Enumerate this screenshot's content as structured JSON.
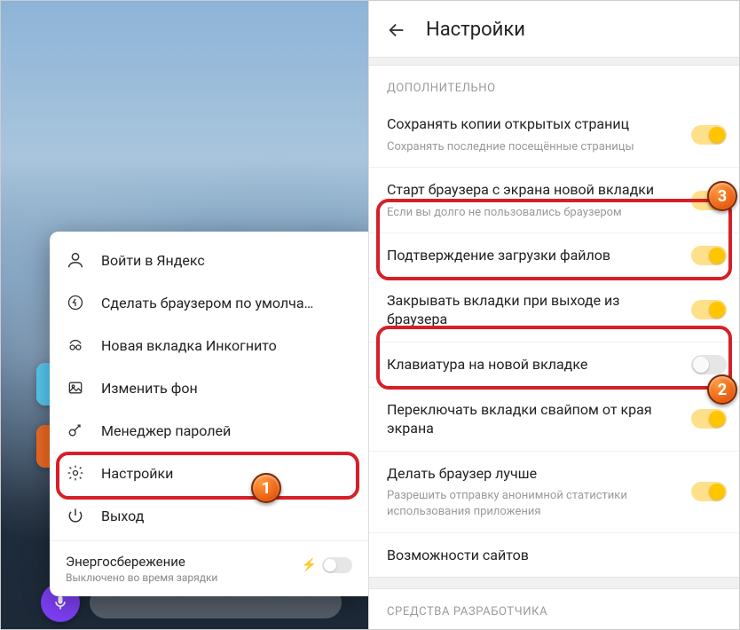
{
  "left": {
    "menu": {
      "login": "Войти в Яндекс",
      "default_browser": "Сделать браузером по умолча…",
      "incognito": "Новая вкладка Инкогнито",
      "change_bg": "Изменить фон",
      "pwd_manager": "Менеджер паролей",
      "settings": "Настройки",
      "exit": "Выход",
      "power_title": "Энергосбережение",
      "power_sub": "Выключено во время зарядки"
    },
    "badges": {
      "one": "1"
    }
  },
  "right": {
    "header": "Настройки",
    "section_extra": "ДОПОЛНИТЕЛЬНО",
    "items": {
      "save_copies": {
        "title": "Сохранять копии открытых страниц",
        "sub": "Сохранять последние посещённые страницы"
      },
      "start_newtab": {
        "title": "Старт браузера с экрана новой вкладки",
        "sub": "Если вы долго не пользовались браузером"
      },
      "confirm_dl": {
        "title": "Подтверждение загрузки файлов"
      },
      "close_tabs": {
        "title": "Закрывать вкладки при выходе из браузера"
      },
      "keyboard": {
        "title": "Клавиатура на новой вкладке"
      },
      "swipe_tabs": {
        "title": "Переключать вкладки свайпом от края экрана"
      },
      "improve": {
        "title": "Делать браузер лучше",
        "sub": "Разрешить отправку анонимной статистики использования приложения"
      },
      "site_caps": {
        "title": "Возможности сайтов"
      }
    },
    "section_dev": "СРЕДСТВА РАЗРАБОТЧИКА",
    "badges": {
      "two": "2",
      "three": "3"
    }
  }
}
